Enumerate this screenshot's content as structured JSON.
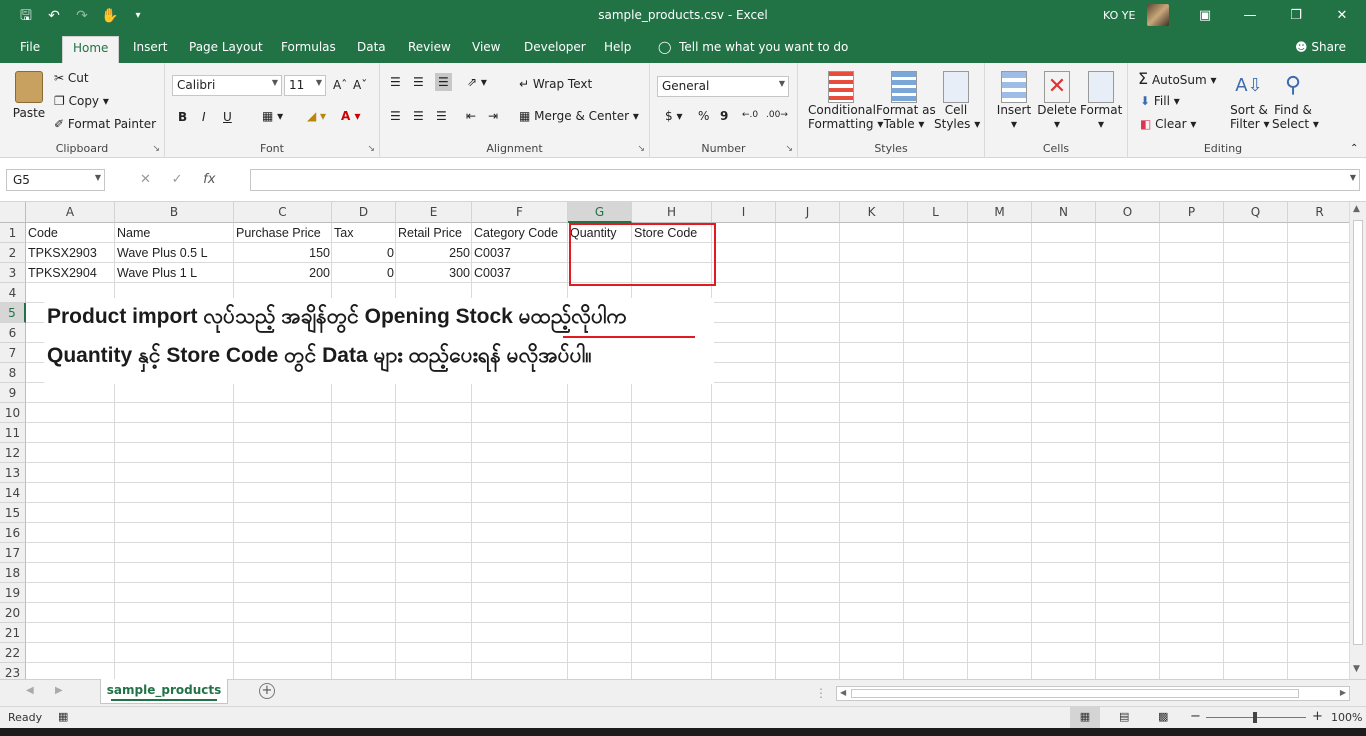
{
  "window": {
    "title": "sample_products.csv  -  Excel",
    "user": "KO YE"
  },
  "tabs": [
    "File",
    "Home",
    "Insert",
    "Page Layout",
    "Formulas",
    "Data",
    "Review",
    "View",
    "Developer",
    "Help"
  ],
  "tell_me": "Tell me what you want to do",
  "share": "Share",
  "ribbon": {
    "clipboard": {
      "paste": "Paste",
      "cut": "Cut",
      "copy": "Copy",
      "format_painter": "Format Painter",
      "label": "Clipboard"
    },
    "font": {
      "name": "Calibri",
      "size": "11",
      "bold": "B",
      "italic": "I",
      "underline": "U",
      "label": "Font"
    },
    "alignment": {
      "wrap_text": "Wrap Text",
      "merge_center": "Merge & Center",
      "label": "Alignment"
    },
    "number": {
      "format": "General",
      "currency": "$",
      "percent": "%",
      "comma": "9",
      "label": "Number"
    },
    "styles": {
      "conditional": "Conditional",
      "formatting": "Formatting",
      "format_as": "Format as",
      "table": "Table",
      "cell": "Cell",
      "cell_styles": "Styles",
      "label": "Styles"
    },
    "cells": {
      "insert": "Insert",
      "delete": "Delete",
      "format": "Format",
      "label": "Cells"
    },
    "editing": {
      "autosum": "AutoSum",
      "fill": "Fill",
      "clear": "Clear",
      "sort": "Sort &",
      "filter": "Filter",
      "find": "Find &",
      "select": "Select",
      "label": "Editing"
    }
  },
  "formula_bar": {
    "name_box": "G5",
    "fx": "fx",
    "value": ""
  },
  "columns": [
    "A",
    "B",
    "C",
    "D",
    "E",
    "F",
    "G",
    "H",
    "I",
    "J",
    "K",
    "L",
    "M",
    "N",
    "O",
    "P",
    "Q",
    "R"
  ],
  "rows": [
    "1",
    "2",
    "3",
    "4",
    "5",
    "6",
    "7",
    "8",
    "9",
    "10",
    "11",
    "12",
    "13",
    "14",
    "15",
    "16",
    "17",
    "18",
    "19",
    "20",
    "21",
    "22",
    "23"
  ],
  "cells": {
    "header": [
      "Code",
      "Name",
      "Purchase Price",
      "Tax",
      "Retail Price",
      "Category Code",
      "Quantity",
      "Store Code"
    ],
    "row2": [
      "TPKSX2903",
      "Wave Plus 0.5 L",
      "150",
      "0",
      "250",
      "C0037"
    ],
    "row3": [
      "TPKSX2904",
      "Wave Plus 1 L",
      "200",
      "0",
      "300",
      "C0037"
    ]
  },
  "annotation": {
    "line1": "Product import လုပ်သည့် အချိန်တွင် Opening Stock မထည့်လိုပါက",
    "line2": "Quantity နှင့် Store Code တွင် Data များ ထည့်ပေးရန် မလိုအပ်ပါ။"
  },
  "sheet_tab": "sample_products",
  "status": {
    "ready": "Ready",
    "zoom": "100%"
  },
  "colors": {
    "excel_green": "#217346",
    "highlight_red": "#e01b24"
  }
}
